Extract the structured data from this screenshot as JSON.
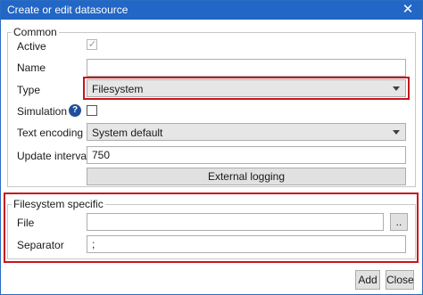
{
  "window": {
    "title": "Create or edit datasource",
    "close_glyph": "✕"
  },
  "common": {
    "legend": "Common",
    "active": {
      "label": "Active",
      "checked": true,
      "enabled": false,
      "check_glyph": "✓"
    },
    "name": {
      "label": "Name",
      "value": ""
    },
    "type": {
      "label": "Type",
      "selected": "Filesystem"
    },
    "simulation": {
      "label": "Simulation",
      "checked": false,
      "help_glyph": "?"
    },
    "text_encoding": {
      "label": "Text encoding",
      "selected": "System default"
    },
    "update_interval": {
      "label": "Update interval (ms)",
      "value": "750"
    },
    "external_logging_button": "External logging"
  },
  "filesystem_specific": {
    "legend": "Filesystem specific",
    "file": {
      "label": "File",
      "value": "",
      "browse_button": ".."
    },
    "separator": {
      "label": "Separator",
      "value": ";"
    }
  },
  "footer": {
    "add_button": "Add",
    "close_button": "Close"
  },
  "colors": {
    "titlebar": "#2266c6",
    "highlight": "#c4161c",
    "help_icon": "#1f4e9c"
  },
  "icons": {
    "close": "close-icon",
    "help": "help-icon",
    "checkmark": "checkmark-icon",
    "dropdown": "chevron-down-icon"
  }
}
